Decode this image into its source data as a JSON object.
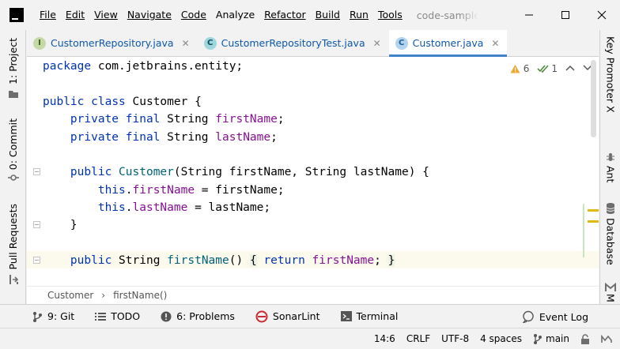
{
  "menu": {
    "items": [
      {
        "label": "File",
        "mnemonic": 0
      },
      {
        "label": "Edit",
        "mnemonic": 0
      },
      {
        "label": "View",
        "mnemonic": 0
      },
      {
        "label": "Navigate",
        "mnemonic": 0
      },
      {
        "label": "Code",
        "mnemonic": 0
      },
      {
        "label": "Analyze",
        "mnemonic": -1
      },
      {
        "label": "Refactor",
        "mnemonic": 0
      },
      {
        "label": "Build",
        "mnemonic": 0
      },
      {
        "label": "Run",
        "mnemonic": 1
      },
      {
        "label": "Tools",
        "mnemonic": 0
      }
    ],
    "window_title": "code-samples"
  },
  "left_tools": {
    "project": "1: Project",
    "commit": "0: Commit",
    "pull_requests": "Pull Requests"
  },
  "right_tools": {
    "key_promoter": "Key Promoter X",
    "ant": "Ant",
    "database": "Database",
    "maven": "M"
  },
  "tabs": [
    {
      "label": "CustomerRepository.java",
      "icon": "interface-icon",
      "icon_letter": "I",
      "active": false
    },
    {
      "label": "CustomerRepositoryTest.java",
      "icon": "test-class-icon",
      "icon_letter": "C",
      "active": false
    },
    {
      "label": "Customer.java",
      "icon": "class-icon",
      "icon_letter": "C",
      "active": true
    }
  ],
  "inspections": {
    "warnings": "6",
    "weak_warnings": "1"
  },
  "code": {
    "l1": [
      "package com.jetbrains.entity;"
    ],
    "l3a": "public",
    "l3b": "class",
    "l3c": "Customer {",
    "l4a": "private",
    "l4b": "final",
    "l4c": "String",
    "l4d": "firstName",
    "l4e": ";",
    "l5a": "private",
    "l5b": "final",
    "l5c": "String",
    "l5d": "lastName",
    "l5e": ";",
    "l7a": "public",
    "l7b": "Customer",
    "l7c": "(String firstName, String lastName) {",
    "l8a": "this",
    "l8b": ".",
    "l8c": "firstName",
    "l8d": " = firstName;",
    "l9a": "this",
    "l9b": ".",
    "l9c": "lastName",
    "l9d": " = lastName;",
    "l10": "}",
    "l12a": "public",
    "l12b": "String",
    "l12c": "firstName",
    "l12d": "()",
    "l12e": "{",
    "l12f": "return",
    "l12g": "firstName",
    "l12h": ";",
    "l12i": "}"
  },
  "breadcrumb": {
    "class": "Customer",
    "method": "firstName()"
  },
  "tool_windows": {
    "git": "9: Git",
    "todo": "TODO",
    "problems": "6: Problems",
    "sonarlint": "SonarLint",
    "terminal": "Terminal",
    "event_log": "Event Log"
  },
  "status": {
    "position": "14:6",
    "line_separator": "CRLF",
    "encoding": "UTF-8",
    "indent": "4 spaces",
    "branch": "main"
  }
}
